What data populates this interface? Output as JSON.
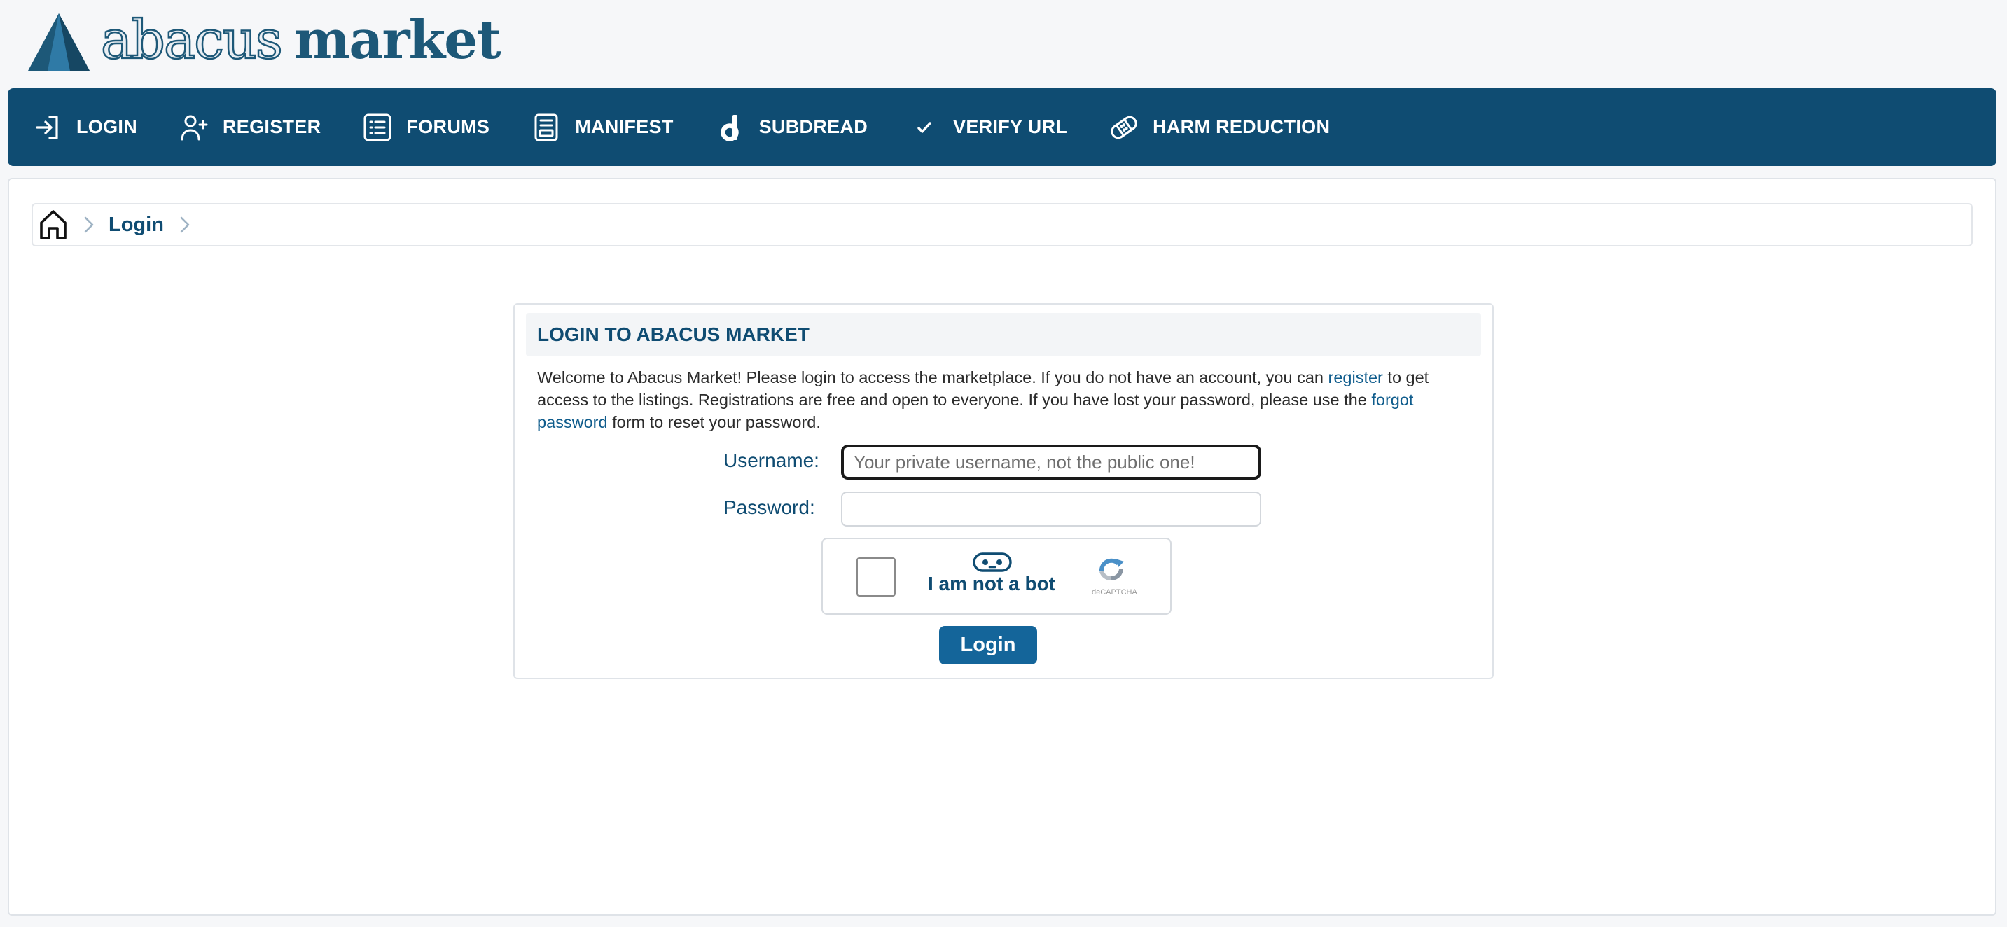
{
  "brand": {
    "name_light": "abacus",
    "name_bold": "market",
    "accent": "#0f4c72",
    "logo_icon": "abacus-logo-icon"
  },
  "nav": {
    "items": [
      {
        "label": "LOGIN",
        "icon": "login-arrow-icon"
      },
      {
        "label": "REGISTER",
        "icon": "user-plus-icon"
      },
      {
        "label": "FORUMS",
        "icon": "list-icon"
      },
      {
        "label": "MANIFEST",
        "icon": "document-icon"
      },
      {
        "label": "SUBDREAD",
        "icon": "dread-d-icon"
      },
      {
        "label": "VERIFY URL",
        "icon": "checkmark-icon"
      },
      {
        "label": "HARM REDUCTION",
        "icon": "bandage-icon"
      }
    ]
  },
  "breadcrumb": {
    "home_icon": "home-icon",
    "current": "Login"
  },
  "login": {
    "title": "LOGIN TO ABACUS MARKET",
    "intro_part1": "Welcome to Abacus Market! Please login to access the marketplace. If you do not have an account, you can ",
    "intro_link_register": "register",
    "intro_part2": " to get access to the listings. Registrations are free and open to everyone. If you have lost your password, please use the ",
    "intro_link_forgot": "forgot password",
    "intro_part3": " form to reset your password.",
    "username_label": "Username:",
    "username_placeholder": "Your private username, not the public one!",
    "username_value": "",
    "password_label": "Password:",
    "password_value": "",
    "captcha_label": "I am not a bot",
    "captcha_brand": "deCAPTCHA",
    "captcha_checked": false,
    "submit_label": "Login"
  }
}
